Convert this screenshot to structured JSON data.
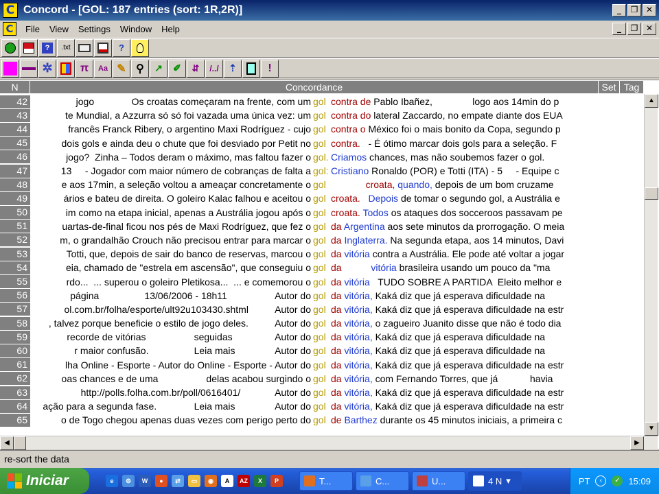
{
  "window": {
    "title": "Concord - [GOL: 187 entries (sort: 1R,2R)]",
    "app_icon": "C"
  },
  "menu": {
    "items": [
      "File",
      "View",
      "Settings",
      "Window",
      "Help"
    ]
  },
  "toolbar1": [
    "green-circle-icon",
    "save-icon",
    "question-book-icon",
    "txt-icon",
    "print-icon",
    "print-preview-icon",
    "help-icon",
    "bulb-icon"
  ],
  "toolbar2": [
    "magenta-square-icon",
    "line-icon",
    "gear-icon",
    "columns-icon",
    "pi-icon",
    "font-icon",
    "clear-icon",
    "search-icon",
    "chart-icon",
    "edit-icon",
    "sort-icon",
    "cut-icon",
    "up-arrow-icon",
    "clipboard-icon",
    "exclaim-icon"
  ],
  "toolbar_labels": {
    "txt": ".txt",
    "help": "?",
    "pi": "π",
    "font": "Aa",
    "exclaim": "!"
  },
  "grid": {
    "headers": {
      "n": "N",
      "concordance": "Concordance",
      "set": "Set",
      "tag": "Tag"
    },
    "rows": [
      {
        "n": "42",
        "left": "jogo              Os croatas começaram na frente, com um",
        "node": "gol",
        "r1": "contra de",
        "r2": "",
        "rest": " Pablo Ibañez,               logo aos 14min do p"
      },
      {
        "n": "43",
        "left": "te Mundial, a Azzurra só só foi vazada uma única vez: um",
        "node": "gol",
        "r1": "contra do",
        "r2": "",
        "rest": " lateral Zaccardo, no empate diante dos EUA"
      },
      {
        "n": "44",
        "left": "francês Franck Ribery, o argentino Maxi Rodríguez - cujo",
        "node": "gol",
        "r1": "contra o",
        "r2": "",
        "rest": " México foi o mais bonito da Copa, segundo p"
      },
      {
        "n": "45",
        "left": "dois gols e ainda deu o chute que foi desviado por Petit no",
        "node": "gol",
        "r1": "contra.",
        "r2": "",
        "rest": "   - É ótimo marcar dois gols para a seleção. F"
      },
      {
        "n": "46",
        "left": "jogo?  Zinha – Todos deram o máximo, mas faltou fazer o",
        "node": "gol.",
        "r1": "",
        "r2": "Criamos",
        "rest": " chances, mas não soubemos fazer o gol."
      },
      {
        "n": "47",
        "left": "13     - Jogador com maior número de cobranças de falta a",
        "node": "gol:",
        "r1": "",
        "r2": "Cristiano",
        "rest": " Ronaldo (POR) e Totti (ITA) - 5     - Equipe c"
      },
      {
        "n": "48",
        "left": "e aos 17min, a seleção voltou a ameaçar concretamente o",
        "node": "gol",
        "r1": "             croata,",
        "r2": " quando,",
        "rest": " depois de um bom cruzame"
      },
      {
        "n": "49",
        "left": "ários e bateu de direita. O goleiro Kalac falhou e aceitou o",
        "node": "gol",
        "r1": "croata.",
        "r2": "   Depois",
        "rest": " de tomar o segundo gol, a Austrália e"
      },
      {
        "n": "50",
        "left": "im como na etapa inicial, apenas a Austrália jogou após o",
        "node": "gol",
        "r1": "croata.",
        "r2": " Todos",
        "rest": " os ataques dos socceroos passavam pe"
      },
      {
        "n": "51",
        "left": "uartas-de-final ficou nos pés de Maxi Rodríguez, que fez o",
        "node": "gol",
        "r1": "da",
        "r2": " Argentina",
        "rest": " aos sete minutos da prorrogação. O meia"
      },
      {
        "n": "52",
        "left": "m, o grandalhão Crouch não precisou entrar para marcar o",
        "node": "gol",
        "r1": "da",
        "r2": " Inglaterra.",
        "rest": " Na segunda etapa, aos 14 minutos, Davi"
      },
      {
        "n": "53",
        "left": "Totti, que, depois de sair do banco de reservas, marcou o",
        "node": "gol",
        "r1": "da",
        "r2": " vitória",
        "rest": " contra a Austrália. Ele pode até voltar a jogar"
      },
      {
        "n": "54",
        "left": "eia, chamado de \"estrela em ascensão\", que conseguiu o",
        "node": "gol",
        "r1": "da",
        "r2": "           vitória",
        "rest": " brasileira usando um pouco da \"ma"
      },
      {
        "n": "55",
        "left": "rdo...  ... superou o goleiro Pletikosa...  ... e comemorou o",
        "node": "gol",
        "r1": "da",
        "r2": " vitória",
        "rest": "   TUDO SOBRE A PARTIDA  Eleito melhor e"
      },
      {
        "n": "56",
        "left": "página                 13/06/2006 - 18h11                  Autor do",
        "node": "gol",
        "r1": "da",
        "r2": " vitória,",
        "rest": " Kaká diz que já esperava dificuldade na"
      },
      {
        "n": "57",
        "left": "ol.com.br/folha/esporte/ult92u103430.shtml          Autor do",
        "node": "gol",
        "r1": "da",
        "r2": " vitória,",
        "rest": " Kaká diz que já esperava dificuldade na estr"
      },
      {
        "n": "58",
        "left": ", talvez porque beneficie o estilo de jogo deles.          Autor do",
        "node": "gol",
        "r1": "da",
        "r2": " vitória,",
        "rest": " o zagueiro Juanito disse que não é todo dia"
      },
      {
        "n": "59",
        "left": "recorde de vitórias                  seguidas                Autor do",
        "node": "gol",
        "r1": "da",
        "r2": " vitória,",
        "rest": " Kaká diz que já esperava dificuldade na"
      },
      {
        "n": "60",
        "left": "r maior confusão.                 Leia mais               Autor do",
        "node": "gol",
        "r1": "da",
        "r2": " vitória,",
        "rest": " Kaká diz que já esperava dificuldade na"
      },
      {
        "n": "61",
        "left": "lha Online - Esporte - Autor do Online - Esporte - Autor do",
        "node": "gol",
        "r1": "da",
        "r2": " vitória,",
        "rest": " Kaká diz que já esperava dificuldade na estr"
      },
      {
        "n": "62",
        "left": "oas chances e de uma                  delas acabou surgindo o",
        "node": "gol",
        "r1": "da",
        "r2": " vitória,",
        "rest": " com Fernando Torres, que já            havia"
      },
      {
        "n": "63",
        "left": "http://polls.folha.com.br/poll/0616401/             Autor do",
        "node": "gol",
        "r1": "da",
        "r2": " vitória,",
        "rest": " Kaká diz que já esperava dificuldade na estr"
      },
      {
        "n": "64",
        "left": "ação para a segunda fase.              Leia mais               Autor do",
        "node": "gol",
        "r1": "da",
        "r2": " vitória,",
        "rest": " Kaká diz que já esperava dificuldade na estr"
      },
      {
        "n": "65",
        "left": "o de Togo chegou apenas duas vezes com perigo perto do",
        "node": "gol",
        "r1": "de",
        "r2": " Barthez",
        "rest": " durante os 45 minutos iniciais, a primeira c"
      }
    ]
  },
  "status": {
    "text": "re-sort the data"
  },
  "taskbar": {
    "start_label": "Iniciar",
    "tasks": [
      {
        "label": "T..."
      },
      {
        "label": "C..."
      },
      {
        "label": "U..."
      },
      {
        "label": "4 N"
      }
    ],
    "tray_lang": "PT",
    "clock": "15:09"
  },
  "colors": {
    "node": "#b59a00",
    "collocate1": "#a00000",
    "collocate2": "#1f3bd0",
    "header": "#808080"
  }
}
